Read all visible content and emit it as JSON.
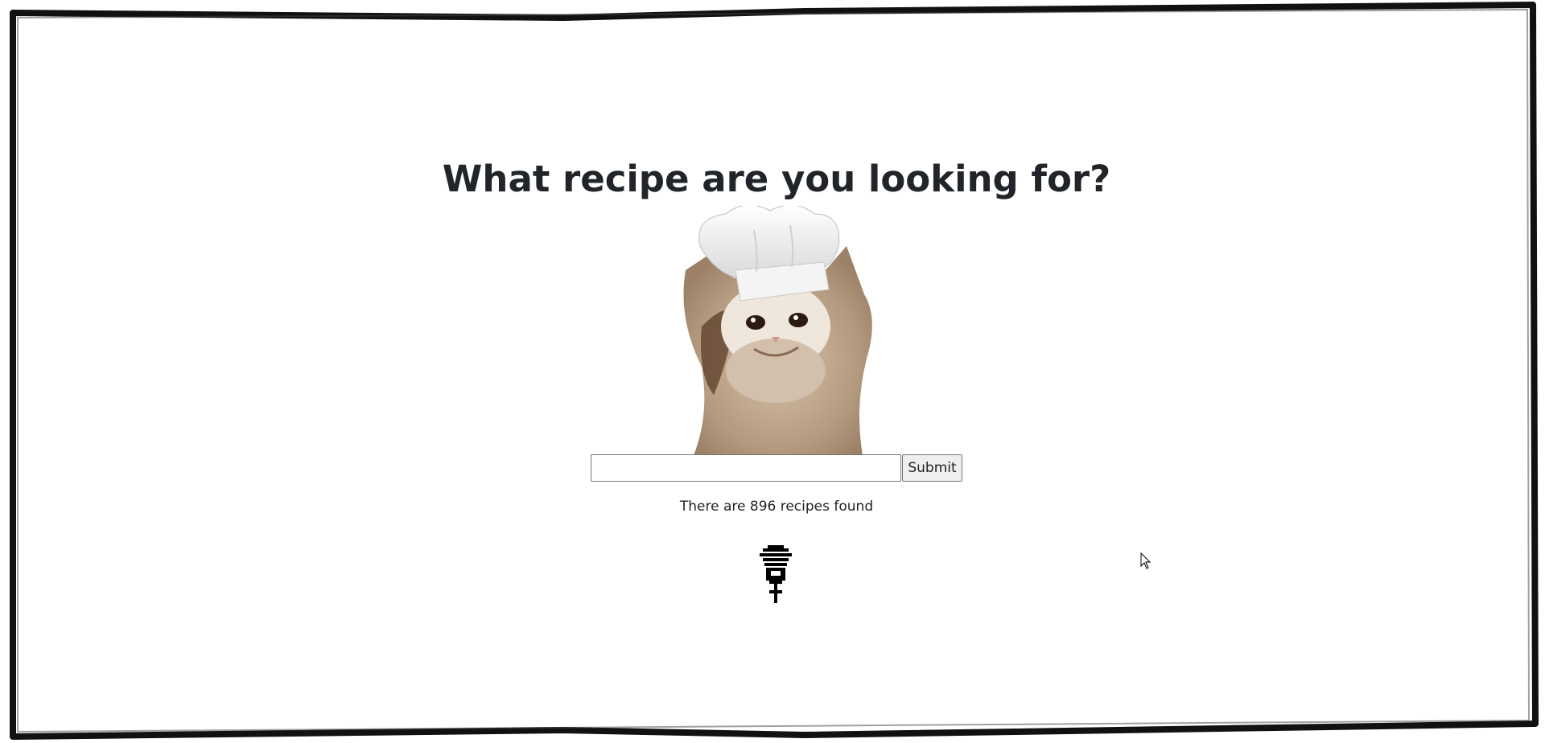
{
  "heading": "What recipe are you looking for?",
  "search": {
    "value": "",
    "placeholder": "",
    "submit_label": "Submit"
  },
  "results": {
    "prefix": "There are ",
    "count": "896",
    "suffix": " recipes found"
  },
  "images": {
    "hero": "cat-wearing-chef-hat",
    "footer_icon": "pixel-whisk-icon"
  },
  "colors": {
    "text": "#212529",
    "frame": "#111111",
    "button_bg": "#efefef",
    "input_border": "#767676"
  }
}
